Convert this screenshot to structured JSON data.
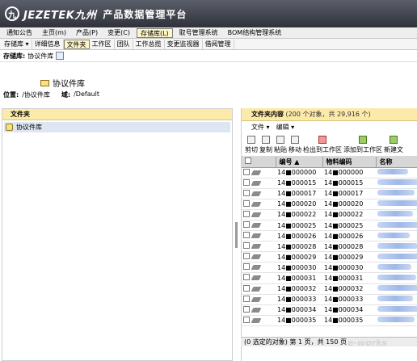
{
  "header": {
    "logo_glyph": "九",
    "brand": "JEZETEK九州",
    "product": "产品数据管理平台"
  },
  "menu1": [
    {
      "label": "通知公告",
      "active": false
    },
    {
      "label": "主页(m)",
      "active": false
    },
    {
      "label": "产品(P)",
      "active": false
    },
    {
      "label": "变更(C)",
      "active": false
    },
    {
      "label": "存储库(L)",
      "active": true
    },
    {
      "label": "取号管理系统",
      "active": false
    },
    {
      "label": "BOM结构管理系统",
      "active": false
    }
  ],
  "menu2": [
    {
      "label": "存储库 ▾",
      "active": false
    },
    {
      "label": "详细信息",
      "active": false
    },
    {
      "label": "文件夹",
      "active": true
    },
    {
      "label": "工作区",
      "active": false
    },
    {
      "label": "团队",
      "active": false
    },
    {
      "label": "工作总揽",
      "active": false
    },
    {
      "label": "变更监视器",
      "active": false
    },
    {
      "label": "借阅管理",
      "active": false
    }
  ],
  "repo": {
    "label": "存储库:",
    "value": "协议件库",
    "icon": "repo-picker-icon"
  },
  "page": {
    "title": "协议件库",
    "location_label": "位置:",
    "location_value": "/协议件库",
    "domain_label": "域:",
    "domain_value": "/Default"
  },
  "left": {
    "header": "文件夹",
    "tree": [
      {
        "label": "协议件库",
        "icon": "folder-tree-icon"
      }
    ]
  },
  "right": {
    "header_title": "文件夹内容",
    "header_count": "(200 个对象，共 29,916 个)",
    "menu": [
      "文件 ▾",
      "编辑 ▾"
    ],
    "toolbar": [
      {
        "label": "剪切",
        "icon": "cut-icon"
      },
      {
        "label": "复制",
        "icon": "copy-icon"
      },
      {
        "label": "粘贴",
        "icon": "paste-icon"
      },
      {
        "label": "移动",
        "icon": "move-icon"
      },
      {
        "label": "检出到工作区",
        "icon": "checkout-icon"
      },
      {
        "label": "添加到工作区",
        "icon": "add-to-workspace-icon"
      },
      {
        "label": "新建文",
        "icon": "new-document-icon"
      }
    ],
    "columns": [
      "编号 ▲",
      "物料编码",
      "名称"
    ],
    "rows": [
      {
        "number": "14■000000",
        "material": "14■000000"
      },
      {
        "number": "14■000015",
        "material": "14■000015"
      },
      {
        "number": "14■000017",
        "material": "14■000017"
      },
      {
        "number": "14■000020",
        "material": "14■000020"
      },
      {
        "number": "14■000022",
        "material": "14■000022"
      },
      {
        "number": "14■000025",
        "material": "14■000025"
      },
      {
        "number": "14■000026",
        "material": "14■000026"
      },
      {
        "number": "14■000028",
        "material": "14■000028"
      },
      {
        "number": "14■000029",
        "material": "14■000029"
      },
      {
        "number": "14■000030",
        "material": "14■000030"
      },
      {
        "number": "14■000031",
        "material": "14■000031"
      },
      {
        "number": "14■000032",
        "material": "14■000032"
      },
      {
        "number": "14■000033",
        "material": "14■000033"
      },
      {
        "number": "14■000034",
        "material": "14■000034"
      },
      {
        "number": "14■000035",
        "material": "14■000035"
      }
    ],
    "status": "(0 选定的对象)  第 1 页，共 150 页"
  },
  "watermark": "e-works"
}
